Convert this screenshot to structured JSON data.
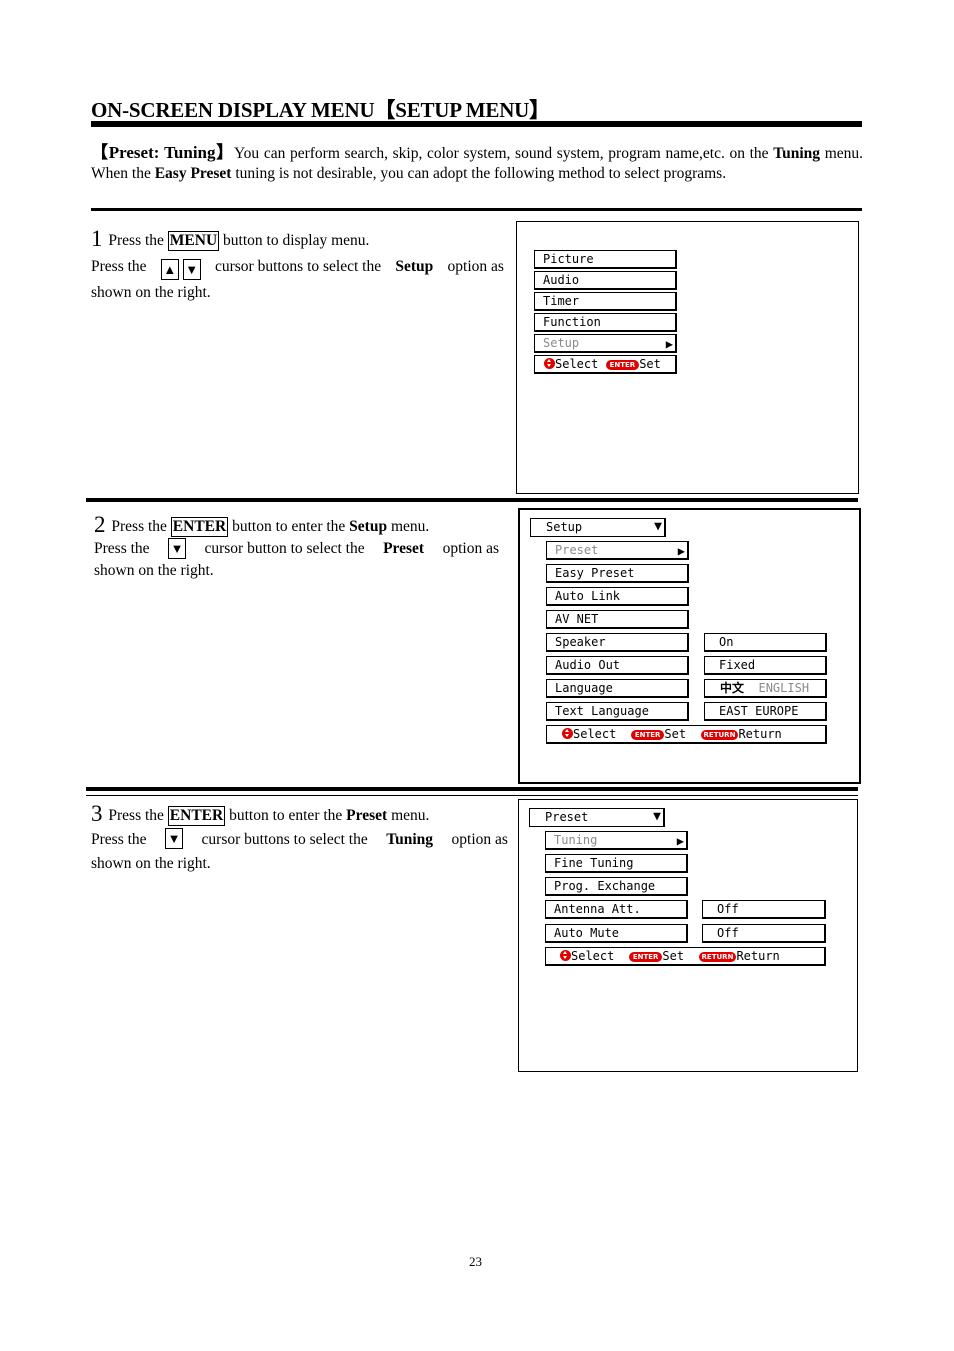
{
  "page": {
    "title": "ON-SCREEN DISPLAY MENU【SETUP MENU】",
    "page_number": "23"
  },
  "intro": {
    "lead": "【Preset:  Tuning】",
    "text_1": "You can perform search, skip, color system, sound system, program name,etc. on the",
    "bold_1": "Tuning",
    "text_2": " menu. When the ",
    "bold_2": "Easy Preset",
    "text_3": " tuning is not desirable, you can adopt the following method to select programs."
  },
  "steps": [
    {
      "number": "1",
      "line1_pre": " Press the ",
      "line1_key": "MENU",
      "line1_post": " button to display menu.",
      "line2_pre": "Press the ",
      "keys": [
        "▲",
        "▼"
      ],
      "line2_mid": " cursor buttons to select the ",
      "line2_bold": "Setup",
      "line2_post": " option as",
      "line3": "shown on the right."
    },
    {
      "number": "2",
      "line1_pre": " Press the ",
      "line1_key": "ENTER",
      "line1_mid": " button to enter the ",
      "line1_bold": "Setup",
      "line1_post": " menu.",
      "line2_pre": "Press the ",
      "keys": [
        "▼"
      ],
      "line2_mid": " cursor button to select the ",
      "line2_bold": "Preset",
      "line2_post": " option as",
      "line3": "shown on the right."
    },
    {
      "number": "3",
      "line1_pre": " Press the ",
      "line1_key": "ENTER",
      "line1_mid": " button to enter the ",
      "line1_bold": "Preset",
      "line1_post": " menu.",
      "line2_pre": "Press the ",
      "keys": [
        "▼"
      ],
      "line2_mid": " cursor buttons to select the ",
      "line2_bold": "Tuning",
      "line2_post": " option as",
      "line3": "shown on the right."
    }
  ],
  "screen1": {
    "items": [
      "Picture",
      "Audio",
      "Timer",
      "Function"
    ],
    "selected": "Setup",
    "footer": {
      "select": "Select",
      "enter_badge": "ENTER",
      "set": "Set"
    }
  },
  "screen2": {
    "header": "Setup",
    "selected": "Preset",
    "items": [
      "Easy Preset",
      "Auto Link",
      "AV NET"
    ],
    "settings": [
      {
        "label": "Speaker",
        "value": "On"
      },
      {
        "label": "Audio Out",
        "value": "Fixed"
      },
      {
        "label": "Language",
        "value_active": "中文",
        "value_inactive": "ENGLISH"
      },
      {
        "label": "Text Language",
        "value": "EAST EUROPE"
      }
    ],
    "footer": {
      "select": "Select",
      "enter_badge": "ENTER",
      "set": "Set",
      "return_badge": "RETURN",
      "return": "Return"
    }
  },
  "screen3": {
    "header": "Preset",
    "selected": "Tuning",
    "items": [
      "Fine Tuning",
      "Prog. Exchange"
    ],
    "settings": [
      {
        "label": "Antenna Att.",
        "value": "Off"
      },
      {
        "label": "Auto Mute",
        "value": "Off"
      }
    ],
    "footer": {
      "select": "Select",
      "enter_badge": "ENTER",
      "set": "Set",
      "return_badge": "RETURN",
      "return": "Return"
    }
  },
  "colors": {
    "accent_red": "#e00000",
    "disabled_grey": "#8a8a8a"
  }
}
